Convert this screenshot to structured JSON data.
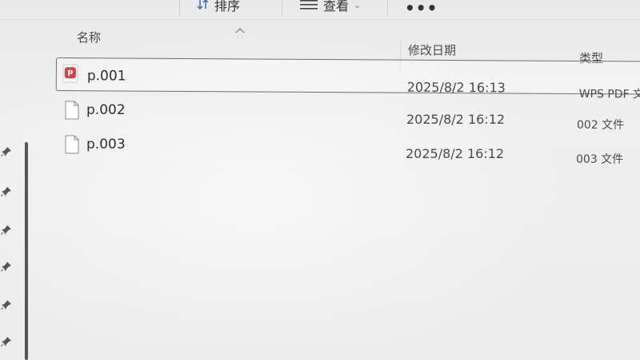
{
  "toolbar": {
    "sort_label": "排序",
    "view_label": "查看",
    "more_label": "•••"
  },
  "columns": {
    "name": "名称",
    "modified": "修改日期",
    "type": "类型"
  },
  "files": [
    {
      "name": "p.001",
      "modified": "2025/8/2 16:13",
      "type": "WPS PDF 文",
      "icon": "wps-pdf-icon",
      "selected": true
    },
    {
      "name": "p.002",
      "modified": "2025/8/2 16:12",
      "type": "002 文件",
      "icon": "generic-file-icon",
      "selected": false
    },
    {
      "name": "p.003",
      "modified": "2025/8/2 16:12",
      "type": "003 文件",
      "icon": "generic-file-icon",
      "selected": false
    }
  ],
  "colors": {
    "pdf_icon": "#d9443a",
    "selection_border": "#6d6d6d"
  }
}
